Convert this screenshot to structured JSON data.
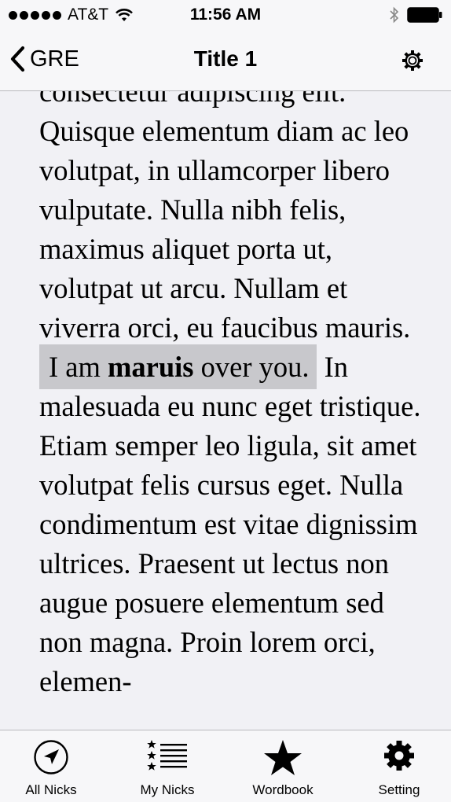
{
  "status_bar": {
    "carrier": "AT&T",
    "time": "11:56 AM",
    "wifi_icon": "wifi-icon",
    "bluetooth_icon": "bluetooth-icon",
    "battery_icon": "battery-icon"
  },
  "nav": {
    "back_label": "GRE",
    "title": "Title 1",
    "settings_icon": "gear-icon"
  },
  "reader": {
    "text_before": "consectetur adipiscing elit. Quisque elementum diam ac leo volutpat, in ullamcorper libero vulputate. Nulla nibh felis, maximus aliquet porta ut, volutpat ut arcu. Nullam et viverra orci, eu faucibus mauris. ",
    "highlight_pre": "I am ",
    "highlight_word": "maruis",
    "highlight_post": " over you.",
    "text_after": " In malesuada eu nunc eget tristique. Etiam semper leo ligula, sit amet volutpat felis cursus eget. Nulla condimentum est vitae dignissim ultrices. Praesent ut lectus non augue posuere elementum sed non magna. Proin lorem orci, elemen-",
    "highlight_color": "#c8c8cc"
  },
  "tabs": [
    {
      "label": "All Nicks",
      "icon": "compass-arrow-icon"
    },
    {
      "label": "My Nicks",
      "icon": "star-list-icon"
    },
    {
      "label": "Wordbook",
      "icon": "star-icon"
    },
    {
      "label": "Setting",
      "icon": "gear-icon"
    }
  ]
}
